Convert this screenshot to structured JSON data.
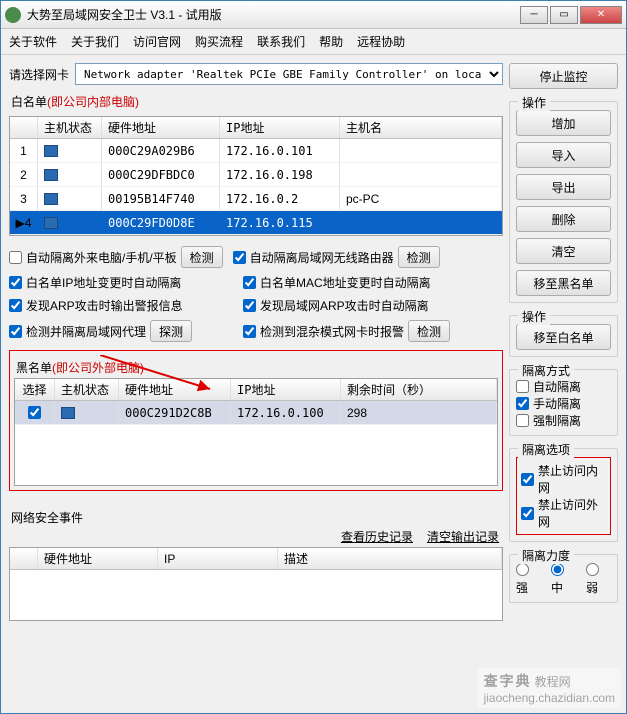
{
  "window": {
    "title": "大势至局域网安全卫士 V3.1 - 试用版"
  },
  "menu": [
    "关于软件",
    "关于我们",
    "访问官网",
    "购买流程",
    "联系我们",
    "帮助",
    "远程协助"
  ],
  "adapter": {
    "label": "请选择网卡",
    "value": "Network adapter 'Realtek PCIe GBE Family Controller' on loca"
  },
  "buttons": {
    "stop_monitor": "停止监控",
    "add": "增加",
    "import": "导入",
    "export": "导出",
    "delete": "删除",
    "clear": "清空",
    "to_blacklist": "移至黑名单",
    "to_whitelist": "移至白名单",
    "detect": "检测",
    "probe": "探测"
  },
  "whitelist": {
    "caption_a": "白名单",
    "caption_b": "(即公司内部电脑)",
    "headers": {
      "status": "主机状态",
      "mac": "硬件地址",
      "ip": "IP地址",
      "host": "主机名"
    },
    "rows": [
      {
        "idx": "1",
        "mac": "000C29A029B6",
        "ip": "172.16.0.101",
        "host": ""
      },
      {
        "idx": "2",
        "mac": "000C29DFBDC0",
        "ip": "172.16.0.198",
        "host": ""
      },
      {
        "idx": "3",
        "mac": "00195B14F740",
        "ip": "172.16.0.2",
        "host": "pc-PC"
      },
      {
        "idx": "4",
        "mac": "000C29FD0D8E",
        "ip": "172.16.0.115",
        "host": "",
        "selected": true
      }
    ]
  },
  "options": {
    "auto_isolate_ext": "自动隔离外来电脑/手机/平板",
    "auto_isolate_wifi": "自动隔离局域网无线路由器",
    "wl_ip_change": "白名单IP地址变更时自动隔离",
    "wl_mac_change": "白名单MAC地址变更时自动隔离",
    "arp_attack_log": "发现ARP攻击时输出警报信息",
    "arp_attack_auto": "发现局域网ARP攻击时自动隔离",
    "detect_proxy": "检测并隔离局域网代理",
    "detect_promisc": "检测到混杂模式网卡时报警"
  },
  "blacklist": {
    "caption_a": "黑名单",
    "caption_b": "(即公司外部电脑)",
    "headers": {
      "sel": "选择",
      "status": "主机状态",
      "mac": "硬件地址",
      "ip": "IP地址",
      "remain": "剩余时间（秒）"
    },
    "rows": [
      {
        "mac": "000C291D2C8B",
        "ip": "172.16.0.100",
        "remain": "298"
      }
    ]
  },
  "events": {
    "caption": "网络安全事件",
    "view_history": "查看历史记录",
    "clear_output": "清空输出记录",
    "headers": {
      "mac": "硬件地址",
      "ip": "IP",
      "desc": "描述"
    }
  },
  "side": {
    "op": "操作",
    "iso_mode": "隔离方式",
    "mode_auto": "自动隔离",
    "mode_manual": "手动隔离",
    "mode_force": "强制隔离",
    "iso_opt": "隔离选项",
    "block_lan": "禁止访问内网",
    "block_wan": "禁止访问外网",
    "iso_strength": "隔离力度",
    "strong": "强",
    "medium": "中",
    "weak": "弱"
  },
  "watermark": {
    "line1": "查字典",
    "line2": "教程网",
    "url": "jiaocheng.chazidian.com"
  }
}
